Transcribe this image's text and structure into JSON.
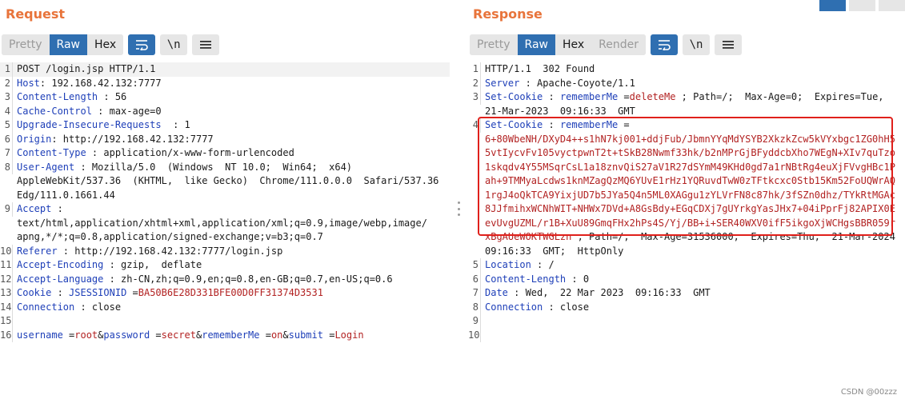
{
  "request": {
    "title": "Request",
    "tabs": [
      "Pretty",
      "Raw",
      "Hex"
    ],
    "active_tab": "Raw",
    "lines": [
      {
        "n": "1",
        "parts": [
          [
            "plain",
            "POST /login.jsp HTTP/1.1"
          ]
        ]
      },
      {
        "n": "2",
        "parts": [
          [
            "hk",
            "Host"
          ],
          [
            "plain",
            ": 192.168.42.132:7777"
          ]
        ]
      },
      {
        "n": "3",
        "parts": [
          [
            "hk",
            "Content-Length"
          ],
          [
            "plain",
            " : 56"
          ]
        ]
      },
      {
        "n": "4",
        "parts": [
          [
            "hk",
            "Cache-Control"
          ],
          [
            "plain",
            " : max-age=0"
          ]
        ]
      },
      {
        "n": "5",
        "parts": [
          [
            "hk",
            "Upgrade-Insecure-Requests"
          ],
          [
            "plain",
            "  : 1"
          ]
        ]
      },
      {
        "n": "6",
        "parts": [
          [
            "hk",
            "Origin"
          ],
          [
            "plain",
            ": http://192.168.42.132:7777"
          ]
        ]
      },
      {
        "n": "7",
        "parts": [
          [
            "hk",
            "Content-Type"
          ],
          [
            "plain",
            " : application/x-www-form-urlencoded"
          ]
        ]
      },
      {
        "n": "8",
        "parts": [
          [
            "hk",
            "User-Agent"
          ],
          [
            "plain",
            " : Mozilla/5.0  (Windows  NT 10.0;  Win64;  x64)"
          ]
        ]
      },
      {
        "n": "",
        "parts": [
          [
            "plain",
            "AppleWebKit/537.36  (KHTML,  like Gecko)  Chrome/111.0.0.0  Safari/537.36"
          ]
        ]
      },
      {
        "n": "",
        "parts": [
          [
            "plain",
            "Edg/111.0.1661.44"
          ]
        ]
      },
      {
        "n": "9",
        "parts": [
          [
            "hk",
            "Accept"
          ],
          [
            "plain",
            " :"
          ]
        ]
      },
      {
        "n": "",
        "parts": [
          [
            "plain",
            "text/html,application/xhtml+xml,application/xml;q=0.9,image/webp,image/"
          ]
        ]
      },
      {
        "n": "",
        "parts": [
          [
            "plain",
            "apng,*/*;q=0.8,application/signed-exchange;v=b3;q=0.7"
          ]
        ]
      },
      {
        "n": "10",
        "parts": [
          [
            "hk",
            "Referer"
          ],
          [
            "plain",
            " : http://192.168.42.132:7777/login.jsp"
          ]
        ]
      },
      {
        "n": "11",
        "parts": [
          [
            "hk",
            "Accept-Encoding"
          ],
          [
            "plain",
            " : gzip,  deflate"
          ]
        ]
      },
      {
        "n": "12",
        "parts": [
          [
            "hk",
            "Accept-Language"
          ],
          [
            "plain",
            " : zh-CN,zh;q=0.9,en;q=0.8,en-GB;q=0.7,en-US;q=0.6"
          ]
        ]
      },
      {
        "n": "13",
        "parts": [
          [
            "hk",
            "Cookie"
          ],
          [
            "plain",
            " : "
          ],
          [
            "pn",
            "JSESSIONID"
          ],
          [
            "plain",
            " ="
          ],
          [
            "pv",
            "BA50B6E28D331BFE00D0FF31374D3531"
          ]
        ]
      },
      {
        "n": "14",
        "parts": [
          [
            "hk",
            "Connection"
          ],
          [
            "plain",
            " : close"
          ]
        ]
      },
      {
        "n": "15",
        "parts": [
          [
            "plain",
            ""
          ]
        ]
      },
      {
        "n": "16",
        "parts": [
          [
            "pn",
            "username"
          ],
          [
            "plain",
            " ="
          ],
          [
            "pv",
            "root"
          ],
          [
            "plain",
            "&"
          ],
          [
            "pn",
            "password"
          ],
          [
            "plain",
            " ="
          ],
          [
            "pv",
            "secret"
          ],
          [
            "plain",
            "&"
          ],
          [
            "pn",
            "rememberMe"
          ],
          [
            "plain",
            " ="
          ],
          [
            "pv",
            "on"
          ],
          [
            "plain",
            "&"
          ],
          [
            "pn",
            "submit"
          ],
          [
            "plain",
            " ="
          ],
          [
            "pv",
            "Login"
          ]
        ]
      }
    ]
  },
  "response": {
    "title": "Response",
    "tabs": [
      "Pretty",
      "Raw",
      "Hex",
      "Render"
    ],
    "active_tab": "Raw",
    "lines": [
      {
        "n": "1",
        "parts": [
          [
            "plain",
            "HTTP/1.1  302 Found"
          ]
        ]
      },
      {
        "n": "2",
        "parts": [
          [
            "hk",
            "Server"
          ],
          [
            "plain",
            " : Apache-Coyote/1.1"
          ]
        ]
      },
      {
        "n": "3",
        "parts": [
          [
            "hk",
            "Set-Cookie"
          ],
          [
            "plain",
            " : "
          ],
          [
            "pn",
            "rememberMe"
          ],
          [
            "plain",
            " ="
          ],
          [
            "pv",
            "deleteMe"
          ],
          [
            "plain",
            " ; Path=/;  Max-Age=0;  Expires=Tue,"
          ]
        ]
      },
      {
        "n": "",
        "parts": [
          [
            "plain",
            "21-Mar-2023  09:16:33  GMT"
          ]
        ]
      },
      {
        "n": "4",
        "parts": [
          [
            "hk",
            "Set-Cookie"
          ],
          [
            "plain",
            " : "
          ],
          [
            "pn",
            "rememberMe"
          ],
          [
            "plain",
            " ="
          ]
        ]
      },
      {
        "n": "",
        "parts": [
          [
            "pv",
            "6+80WbeNH/DXyD4++s1hN7kj001+ddjFub/JbmnYYqMdYSYB2XkzkZcw5kVYxbgc1ZG0hH5"
          ]
        ]
      },
      {
        "n": "",
        "parts": [
          [
            "pv",
            "5vtIycvFv105vyctpwnT2t+tSkB28Nwmf33hk/b2nMPrGjBFyddcbXho7WEgN+XIv7quTzo"
          ]
        ]
      },
      {
        "n": "",
        "parts": [
          [
            "pv",
            "1skqdv4Y55MSqrCsL1a18znvQiS27aV1R27dSYmM49KHd0gd7a1rNBtRg4euXjFVvgHBc1P"
          ]
        ]
      },
      {
        "n": "",
        "parts": [
          [
            "pv",
            "ah+9TMMyaLcdws1knMZagQzMQ6YUvE1rHz1YQRuvdTwW0zTFtkcxc0Stb15Km52FoUQWrAQ"
          ]
        ]
      },
      {
        "n": "",
        "parts": [
          [
            "pv",
            "1rgJ4oQkTCA9YixjUD7b5JYa5Q4n5ML0XAGgu1zYLVrFN8c87hk/3fSZn0dhz/TYkRtMGAc"
          ]
        ]
      },
      {
        "n": "",
        "parts": [
          [
            "pv",
            "8JJfmihxWCNhWIT+NHWx7DVd+A8GsBdy+EGqCDXj7gUYrkgYasJHx7+04iPprFj82APIX0E"
          ]
        ]
      },
      {
        "n": "",
        "parts": [
          [
            "pv",
            "evUvgUZML/r1B+XuU89GmqFHx2hPs4S/Yj/BB+i+SER40WXV0ifF5ikgoXjWCHgsBBR059r"
          ]
        ]
      },
      {
        "n": "",
        "parts": [
          [
            "pv",
            "xBgAUeWOKTWGLzn"
          ],
          [
            "plain",
            " ; Path=/;  Max-Age=31536000;  Expires=Thu,  21-Mar-2024"
          ]
        ]
      },
      {
        "n": "",
        "parts": [
          [
            "plain",
            "09:16:33  GMT;  HttpOnly"
          ]
        ]
      },
      {
        "n": "5",
        "parts": [
          [
            "hk",
            "Location"
          ],
          [
            "plain",
            " : /"
          ]
        ]
      },
      {
        "n": "6",
        "parts": [
          [
            "hk",
            "Content-Length"
          ],
          [
            "plain",
            " : 0"
          ]
        ]
      },
      {
        "n": "7",
        "parts": [
          [
            "hk",
            "Date"
          ],
          [
            "plain",
            " : Wed,  22 Mar 2023  09:16:33  GMT"
          ]
        ]
      },
      {
        "n": "8",
        "parts": [
          [
            "hk",
            "Connection"
          ],
          [
            "plain",
            " : close"
          ]
        ]
      },
      {
        "n": "9",
        "parts": [
          [
            "plain",
            ""
          ]
        ]
      },
      {
        "n": "10",
        "parts": [
          [
            "plain",
            ""
          ]
        ]
      }
    ]
  },
  "icons": {
    "wrap": "wrap-icon",
    "newline": "\\n",
    "menu": "menu-icon"
  },
  "colors": {
    "title": "#e8743b",
    "active_tab": "#2f6fb1",
    "header_key": "#1e3fb8",
    "param_value": "#b22222",
    "highlight_box": "#e0201b"
  },
  "watermark": "CSDN @00zzz"
}
